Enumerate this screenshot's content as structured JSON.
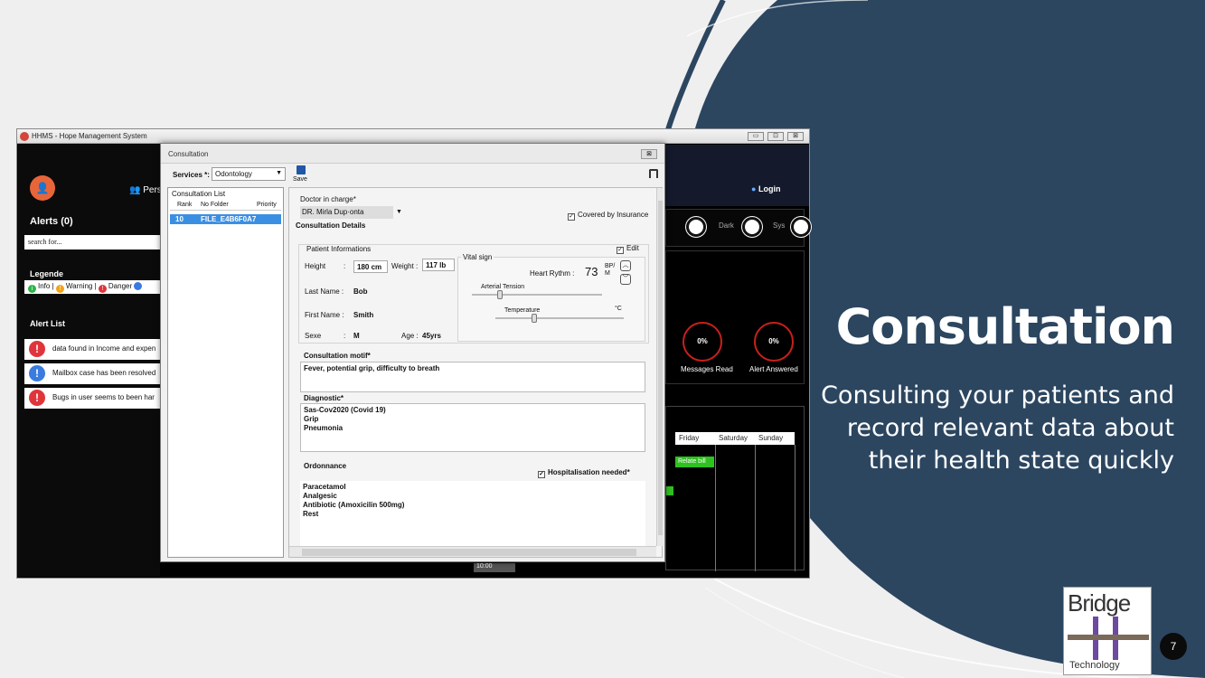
{
  "slide": {
    "headline": "Consultation",
    "subline": "Consulting your patients and record relevant data about their health state quickly",
    "logo_text": "Bridge",
    "logo_sub": "Technology",
    "page_number": "7",
    "colors": {
      "navy": "#2c4660",
      "background": "#efefef"
    }
  },
  "window": {
    "title": "HHMS - Hope Management System",
    "controls": [
      "▭",
      "⊡",
      "⊠"
    ]
  },
  "sidebar": {
    "alerts_title": "Alerts (0)",
    "search_placeholder": "search for...",
    "legend_title": "Legende",
    "legend": [
      {
        "label": "Info",
        "color": "#2db34a"
      },
      {
        "label": "Warning",
        "color": "#f2a316"
      },
      {
        "label": "Danger",
        "color": "#e0353b"
      }
    ],
    "alert_list_title": "Alert List",
    "alerts": [
      {
        "text": "data found in Income and expen",
        "color": "#e0353b"
      },
      {
        "text": "Mailbox case has been resolved",
        "color": "#3a7be0"
      },
      {
        "text": "Bugs in user seems to been har",
        "color": "#e0353b"
      }
    ]
  },
  "topbar": {
    "personnel_label": "Pers",
    "login_label": "Login"
  },
  "theme": {
    "dark_label": "Dark",
    "sys_label": "Sys"
  },
  "stats": [
    {
      "value": "0%",
      "label": "Messages Read"
    },
    {
      "value": "0%",
      "label": "Alert Answered"
    }
  ],
  "calendar": {
    "days": [
      "Friday",
      "Saturday",
      "Sunday"
    ],
    "event": "Relate bill",
    "time": "10:00"
  },
  "dialog": {
    "title": "Consultation",
    "close": "⊠",
    "services_label": "Services *:",
    "services_value": "Odontology",
    "save_label": "Save",
    "list_title": "Consultation List",
    "list_columns": [
      "Rank",
      "No Folder",
      "Priority"
    ],
    "list_rows": [
      {
        "rank": "10",
        "folder": "FILE_E4B6F0A7",
        "priority": ""
      }
    ],
    "doctor_label": "Doctor in charge*",
    "doctor_value": "DR. Mirla Dup·onta",
    "insurance_label": "Covered by Insurance",
    "insurance_checked": true,
    "details_title": "Consultation Details",
    "patient_title": "Patient Informations",
    "edit_label": "Edit",
    "edit_checked": true,
    "height_label": "Height",
    "height_value": "180 cm",
    "weight_label": "Weight :",
    "weight_value": "117 lb",
    "lastname_label": "Last Name :",
    "lastname_value": "Bob",
    "firstname_label": "First Name :",
    "firstname_value": "Smith",
    "sex_label": "Sexe",
    "sex_value": "M",
    "age_label": "Age :",
    "age_value": "45yrs",
    "vital_title": "Vital sign",
    "heart_label": "Heart Rythm :",
    "heart_value": "73",
    "heart_unit": "BP/ M",
    "tension_label": "Arterial Tension",
    "temperature_label": "Temperature",
    "temperature_unit": "°C",
    "motif_label": "Consultation motif*",
    "motif_value": "Fever, potential grip, difficulty to breath",
    "diag_label": "Diagnostic*",
    "diag_value": "Sas-Cov2020 (Covid 19)\nGrip\nPneumonia",
    "ord_label": "Ordonnance",
    "hosp_label": "Hospitalisation needed*",
    "hosp_checked": true,
    "ord_value": "Paracetamol\nAnalgesic\nAntibiotic (Amoxicilin 500mg)\nRest"
  }
}
